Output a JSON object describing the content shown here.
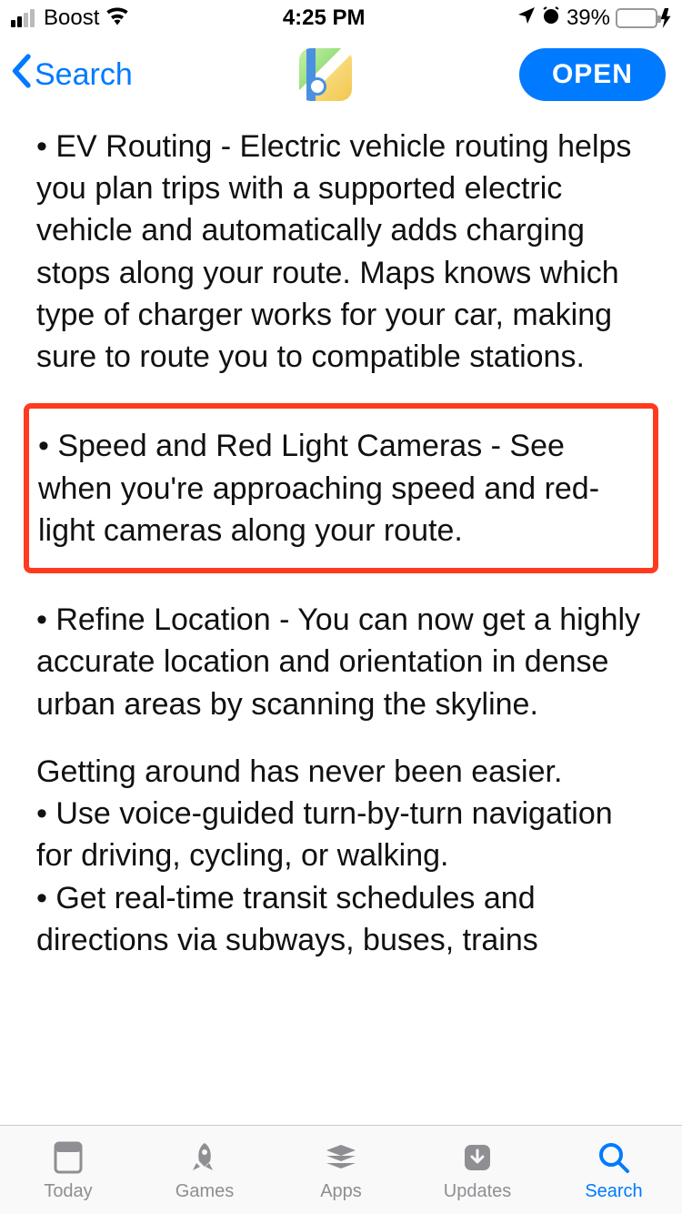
{
  "status": {
    "carrier": "Boost",
    "time": "4:25 PM",
    "battery_pct": "39%"
  },
  "nav": {
    "back_label": "Search",
    "open_label": "OPEN"
  },
  "content": {
    "p1": "• EV Routing - Electric vehicle routing helps you plan trips with a supported electric vehicle and automatically adds charging stops along your route. Maps knows which type of charger works for your car, making sure to route you to compatible stations.",
    "p2": "• Speed and Red Light Cameras - See when you're approaching speed and red-light cameras along your route.",
    "p3": "• Refine Location - You can now get a highly accurate location and orientation in dense urban areas by scanning the skyline.",
    "p4": "Getting around has never been easier.",
    "p5": "• Use voice-guided turn-by-turn navigation for driving, cycling, or walking.",
    "p6": "• Get real-time transit schedules and directions via subways, buses, trains"
  },
  "tabs": {
    "today": "Today",
    "games": "Games",
    "apps": "Apps",
    "updates": "Updates",
    "search": "Search"
  }
}
